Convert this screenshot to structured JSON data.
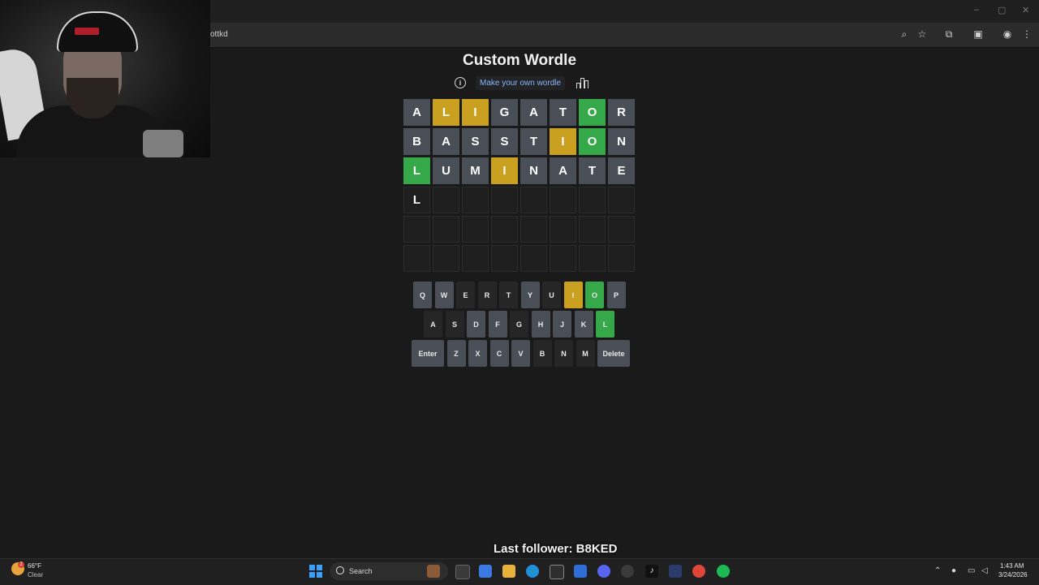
{
  "browser": {
    "url_fragment": "ottkd",
    "window_controls": [
      "–",
      "▢",
      "✕"
    ],
    "toolbar_icons": [
      "zoom-icon",
      "star-icon",
      "extensions-icon",
      "tab-search-icon",
      "profile-icon",
      "menu-icon"
    ]
  },
  "game": {
    "title": "Custom Wordle",
    "make_link": "Make your own wordle",
    "board": [
      [
        [
          "A",
          "gray"
        ],
        [
          "L",
          "yellow"
        ],
        [
          "I",
          "yellow"
        ],
        [
          "G",
          "gray"
        ],
        [
          "A",
          "gray"
        ],
        [
          "T",
          "gray"
        ],
        [
          "O",
          "green"
        ],
        [
          "R",
          "gray"
        ]
      ],
      [
        [
          "B",
          "gray"
        ],
        [
          "A",
          "gray"
        ],
        [
          "S",
          "gray"
        ],
        [
          "S",
          "gray"
        ],
        [
          "T",
          "gray"
        ],
        [
          "I",
          "yellow"
        ],
        [
          "O",
          "green"
        ],
        [
          "N",
          "gray"
        ]
      ],
      [
        [
          "L",
          "green"
        ],
        [
          "U",
          "gray"
        ],
        [
          "M",
          "gray"
        ],
        [
          "I",
          "yellow"
        ],
        [
          "N",
          "gray"
        ],
        [
          "A",
          "gray"
        ],
        [
          "T",
          "gray"
        ],
        [
          "E",
          "gray"
        ]
      ],
      [
        [
          "L",
          "typed"
        ],
        [
          "",
          "empty"
        ],
        [
          "",
          "empty"
        ],
        [
          "",
          "empty"
        ],
        [
          "",
          "empty"
        ],
        [
          "",
          "empty"
        ],
        [
          "",
          "empty"
        ],
        [
          "",
          "empty"
        ]
      ],
      [
        [
          "",
          "empty"
        ],
        [
          "",
          "empty"
        ],
        [
          "",
          "empty"
        ],
        [
          "",
          "empty"
        ],
        [
          "",
          "empty"
        ],
        [
          "",
          "empty"
        ],
        [
          "",
          "empty"
        ],
        [
          "",
          "empty"
        ]
      ],
      [
        [
          "",
          "empty"
        ],
        [
          "",
          "empty"
        ],
        [
          "",
          "empty"
        ],
        [
          "",
          "empty"
        ],
        [
          "",
          "empty"
        ],
        [
          "",
          "empty"
        ],
        [
          "",
          "empty"
        ],
        [
          "",
          "empty"
        ]
      ]
    ],
    "keyboard": [
      [
        [
          "Q",
          "def"
        ],
        [
          "W",
          "def"
        ],
        [
          "E",
          "absent"
        ],
        [
          "R",
          "absent"
        ],
        [
          "T",
          "absent"
        ],
        [
          "Y",
          "def"
        ],
        [
          "U",
          "absent"
        ],
        [
          "I",
          "yellow"
        ],
        [
          "O",
          "green"
        ],
        [
          "P",
          "def"
        ]
      ],
      [
        [
          "A",
          "absent"
        ],
        [
          "S",
          "absent"
        ],
        [
          "D",
          "def"
        ],
        [
          "F",
          "def"
        ],
        [
          "G",
          "absent"
        ],
        [
          "H",
          "def"
        ],
        [
          "J",
          "def"
        ],
        [
          "K",
          "def"
        ],
        [
          "L",
          "green"
        ]
      ],
      [
        [
          "Enter",
          "def"
        ],
        [
          "Z",
          "def"
        ],
        [
          "X",
          "def"
        ],
        [
          "C",
          "def"
        ],
        [
          "V",
          "def"
        ],
        [
          "B",
          "absent"
        ],
        [
          "N",
          "absent"
        ],
        [
          "M",
          "absent"
        ],
        [
          "Delete",
          "def"
        ]
      ]
    ]
  },
  "overlay": {
    "last_follower": "Last follower: B8KED"
  },
  "taskbar": {
    "weather_badge": "2",
    "weather_temp": "66°F",
    "weather_desc": "Clear",
    "search_text": "Search",
    "time": "1:43 AM",
    "date": "3/24/2026"
  },
  "colors": {
    "gray": "#4a4f57",
    "yellow": "#c9a01f",
    "green": "#35a84a",
    "absent": "#262626",
    "background": "#1a1a1a"
  }
}
